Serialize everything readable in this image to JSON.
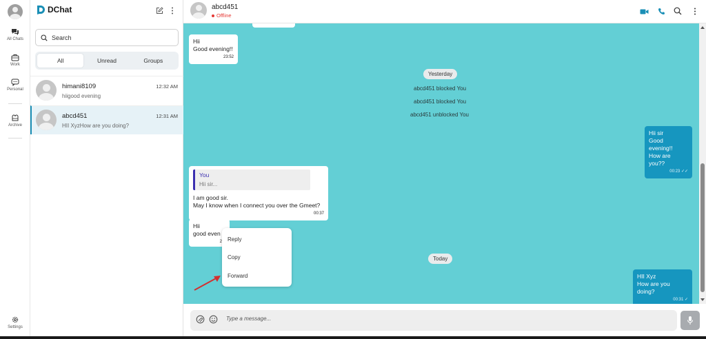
{
  "colors": {
    "accent": "#1696bf",
    "chat_background": "#63cfd5",
    "offline": "#e53935",
    "reply_bar": "#3b2fb0"
  },
  "rail": {
    "items": [
      {
        "label": "All Chats",
        "icon": "chats-icon"
      },
      {
        "label": "Work",
        "icon": "briefcase-icon"
      },
      {
        "label": "Personal",
        "icon": "speech-bubble-icon"
      },
      {
        "label": "Archive",
        "icon": "archive-icon"
      }
    ],
    "settings_label": "Settings"
  },
  "list": {
    "brand": "DChat",
    "search_placeholder": "Search",
    "filters": [
      {
        "label": "All",
        "active": true
      },
      {
        "label": "Unread",
        "active": false
      },
      {
        "label": "Groups",
        "active": false
      }
    ],
    "conversations": [
      {
        "name": "himani8109",
        "preview": "hiigood evening",
        "time": "12:32 AM",
        "selected": false
      },
      {
        "name": "abcd451",
        "preview": "HII XyzHow are you doing?",
        "time": "12:31 AM",
        "selected": true
      }
    ]
  },
  "chat": {
    "contact_name": "abcd451",
    "status": "Offline",
    "messages": {
      "m1": {
        "lines": [
          "Hii",
          "Good evening!!"
        ],
        "time": "23:52"
      },
      "yesterday": "Yesterday",
      "sys1": "abcd451 blocked You",
      "sys2": "abcd451 blocked You",
      "sys3": "abcd451 unblocked You",
      "m2": {
        "lines": [
          "Hii sir",
          "Good evening!!",
          "How are you??"
        ],
        "time": "00:23"
      },
      "m3": {
        "quote_name": "You",
        "quote_text": "Hii sir...",
        "lines": [
          "I am good sir.",
          "May I know when I connect you over the Gmeet?"
        ],
        "time": "00:37"
      },
      "m4": {
        "lines": [
          "Hii",
          "good even"
        ],
        "time": "21:"
      },
      "today": "Today",
      "m5": {
        "lines": [
          "HII Xyz",
          "How are you doing?"
        ],
        "time": "00:31"
      }
    },
    "context_menu": [
      "Reply",
      "Copy",
      "Forward"
    ],
    "composer_placeholder": "Type a message..."
  }
}
